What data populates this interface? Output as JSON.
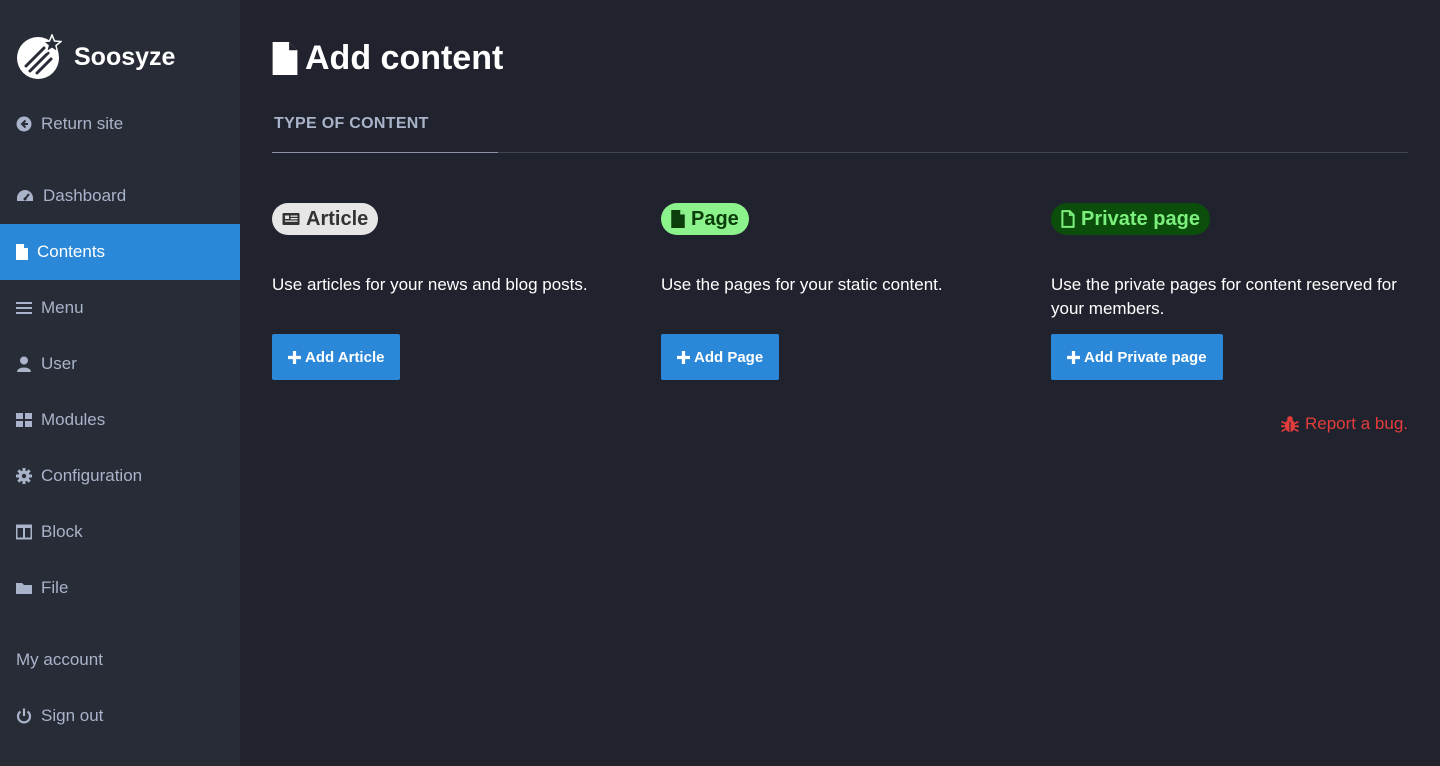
{
  "brand": {
    "name": "Soosyze",
    "logo_icon": "shooting-star-logo"
  },
  "sidebar": {
    "return_site": {
      "label": "Return site",
      "icon": "circle-arrow-left-icon"
    },
    "items": [
      {
        "label": "Dashboard",
        "icon": "tachometer-icon"
      },
      {
        "label": "Contents",
        "icon": "file-icon",
        "active": true
      },
      {
        "label": "Menu",
        "icon": "bars-icon"
      },
      {
        "label": "User",
        "icon": "user-icon"
      },
      {
        "label": "Modules",
        "icon": "cubes-icon"
      },
      {
        "label": "Configuration",
        "icon": "cog-icon"
      },
      {
        "label": "Block",
        "icon": "columns-icon"
      },
      {
        "label": "File",
        "icon": "folder-icon"
      }
    ],
    "my_account": "My account",
    "sign_out": {
      "label": "Sign out",
      "icon": "power-icon"
    }
  },
  "page": {
    "title": "Add content",
    "title_icon": "file-icon",
    "tab": "TYPE OF CONTENT"
  },
  "content_types": [
    {
      "badge": "Article",
      "icon": "newspaper-icon",
      "badge_bg": "#e6e6e6",
      "badge_color": "#333333",
      "description": "Use articles for your news and blog posts.",
      "button": "Add Article"
    },
    {
      "badge": "Page",
      "icon": "file-icon",
      "badge_bg": "#8cf28c",
      "badge_color": "#0b3d0b",
      "description": "Use the pages for your static content.",
      "button": "Add Page"
    },
    {
      "badge": "Private page",
      "icon": "file-outline-icon",
      "badge_bg": "#0b4d0b",
      "badge_color": "#7cf07c",
      "description": "Use the private pages for content reserved for your members.",
      "button": "Add Private page"
    }
  ],
  "report_bug": {
    "label": "Report a bug.",
    "icon": "bug-icon"
  },
  "colors": {
    "background": "#20232d",
    "sidebar": "#282c37",
    "accent": "#2b88d8",
    "muted_text": "#a9b3c9",
    "danger": "#e23c3c"
  }
}
